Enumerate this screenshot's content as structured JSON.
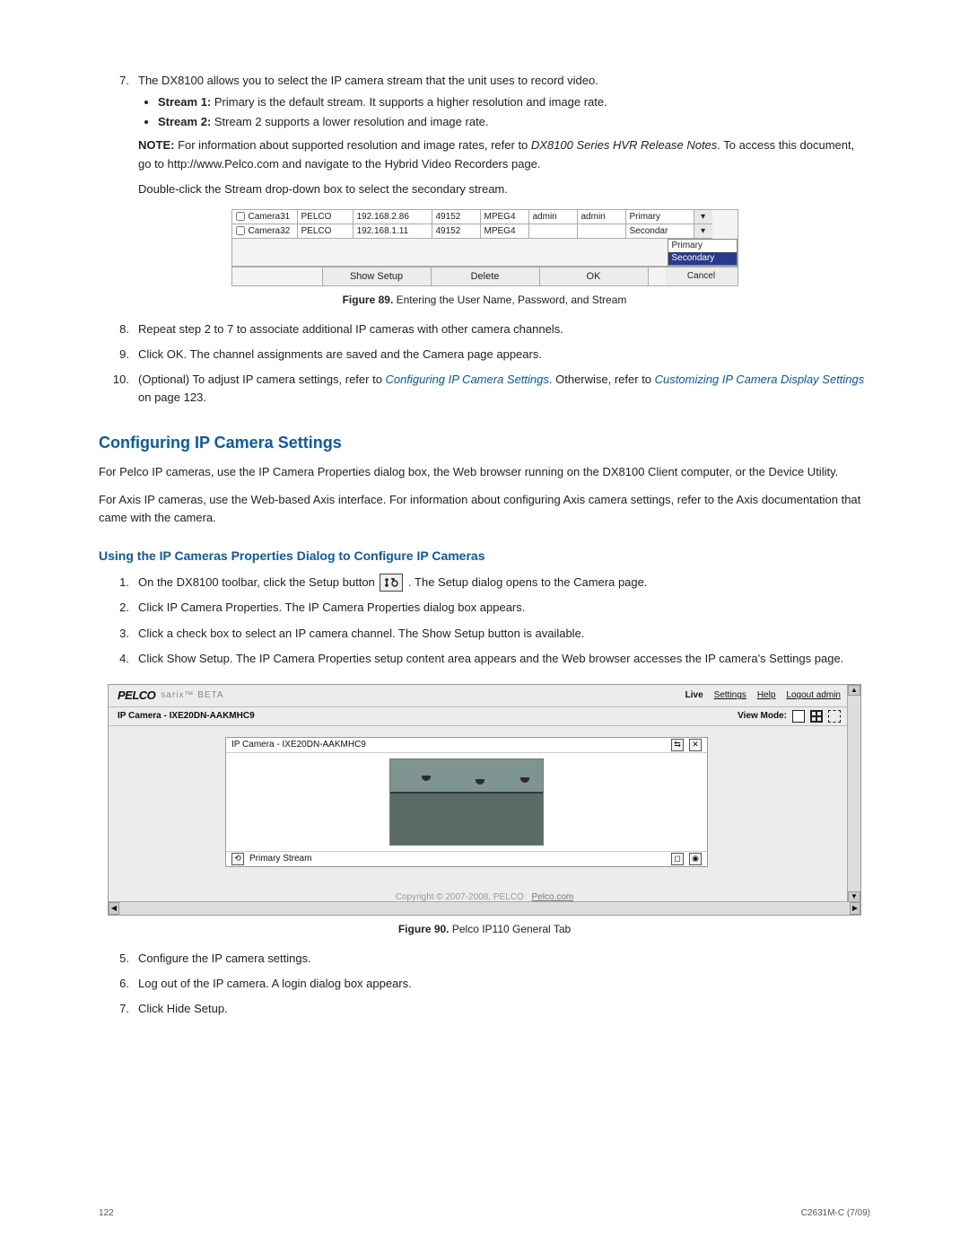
{
  "step7": {
    "num": "7.",
    "text": "The DX8100 allows you to select the IP camera stream that the unit uses to record video.",
    "bullets": [
      {
        "label": "Stream 1:",
        "text": " Primary is the default stream. It supports a higher resolution and image rate."
      },
      {
        "label": "Stream 2:",
        "text": " Stream 2 supports a lower resolution and image rate."
      }
    ],
    "note": {
      "label": "NOTE:",
      "text_1": " For information about supported resolution and image rates, refer to ",
      "doc": "DX8100 Series HVR Release Notes",
      "text_2": ". To access this document, go to http://www.Pelco.com and navigate to the Hybrid Video Recorders page."
    },
    "tail": "Double-click the Stream drop-down box to select the secondary stream."
  },
  "fig89": {
    "rows": [
      {
        "name": "Camera31",
        "make": "PELCO",
        "ip": "192.168.2.86",
        "port": "49152",
        "codec": "MPEG4",
        "user": "admin",
        "pw": "admin",
        "stream": "Primary"
      },
      {
        "name": "Camera32",
        "make": "PELCO",
        "ip": "192.168.1.11",
        "port": "49152",
        "codec": "MPEG4",
        "user": "",
        "pw": "",
        "stream": "Secondar"
      }
    ],
    "dropdown": {
      "opt1": "Primary",
      "opt2": "Secondary"
    },
    "buttons": {
      "show": "Show Setup",
      "delete": "Delete",
      "ok": "OK",
      "cancel": "Cancel"
    },
    "caption_b": "Figure 89.",
    "caption_t": "  Entering the User Name, Password, and Stream"
  },
  "steps_8_10": {
    "s8_num": "8.",
    "s8": "Repeat step 2 to 7 to associate additional IP cameras with other camera channels.",
    "s9_num": "9.",
    "s9": "Click OK. The channel assignments are saved and the Camera page appears.",
    "s10_num": "10.",
    "s10_a": "(Optional) To adjust IP camera settings, refer to ",
    "s10_link1": "Configuring IP Camera Settings",
    "s10_b": ". Otherwise, refer to ",
    "s10_link2": "Customizing IP Camera Display Settings",
    "s10_c": " on page 123."
  },
  "h2_config": "Configuring IP Camera Settings",
  "p_pelco": "For Pelco IP cameras, use the IP Camera Properties dialog box, the Web browser running on the DX8100 Client computer, or the Device Utility.",
  "p_axis": "For Axis IP cameras, use the Web-based Axis interface. For information about configuring Axis camera settings, refer to the Axis documentation that came with the camera.",
  "h3_using": "Using the IP Cameras Properties Dialog to Configure IP Cameras",
  "steps_1_4": {
    "s1_num": "1.",
    "s1_a": "On the DX8100 toolbar, click the Setup button ",
    "s1_b": ". The Setup dialog opens to the Camera page.",
    "s2_num": "2.",
    "s2": "Click IP Camera Properties. The IP Camera Properties dialog box appears.",
    "s3_num": "3.",
    "s3": "Click a check box to select an IP camera channel. The Show Setup button is available.",
    "s4_num": "4.",
    "s4": "Click Show Setup. The IP Camera Properties setup content area appears and the Web browser accesses the IP camera's Settings page."
  },
  "fig90": {
    "brand_logo": "PELCO",
    "brand_tag": "sarix™ BETA",
    "links": {
      "live": "Live",
      "settings": "Settings",
      "help": "Help",
      "logout": "Logout admin"
    },
    "sub_title": "IP Camera - IXE20DN-AAKMHC9",
    "viewmode_label": "View Mode:",
    "panel_title": "IP Camera - IXE20DN-AAKMHC9",
    "panel_foot_icon": "⟲",
    "panel_foot_label": "Primary Stream",
    "footer_copy": "Copyright © 2007-2008, PELCO",
    "footer_link": "Pelco.com",
    "caption_b": "Figure 90.",
    "caption_t": "  Pelco IP110 General Tab"
  },
  "steps_5_7": {
    "s5_num": "5.",
    "s5": "Configure the IP camera settings.",
    "s6_num": "6.",
    "s6": "Log out of the IP camera. A login dialog box appears.",
    "s7_num": "7.",
    "s7": "Click Hide Setup."
  },
  "footer": {
    "page": "122",
    "doc": "C2631M-C (7/09)"
  }
}
